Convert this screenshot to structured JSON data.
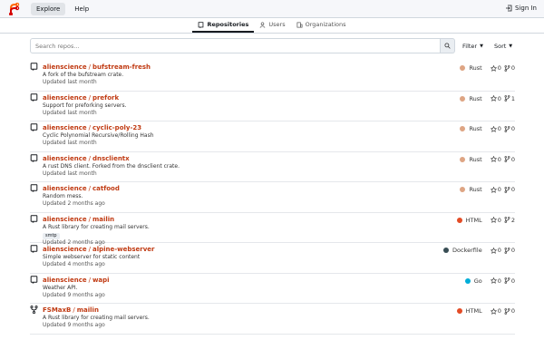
{
  "nav": {
    "explore": "Explore",
    "help": "Help",
    "signin": "Sign In"
  },
  "tabs": [
    {
      "label": "Repositories",
      "icon": "repo-icon"
    },
    {
      "label": "Users",
      "icon": "person-icon"
    },
    {
      "label": "Organizations",
      "icon": "organization-icon"
    }
  ],
  "search": {
    "placeholder": "Search repos..."
  },
  "filters": {
    "filter": "Filter",
    "sort": "Sort"
  },
  "colors": {
    "accent": "#c03a12",
    "Rust": "#dea584",
    "HTML": "#e34c26",
    "Dockerfile": "#384d54",
    "Go": "#00add8"
  },
  "repos": [
    {
      "owner": "alienscience",
      "name": "bufstream-fresh",
      "desc": "A fork of the bufstream crate.",
      "updated": "Updated last month",
      "lang": "Rust",
      "stars": "0",
      "forks": "0",
      "icon": "repo-icon"
    },
    {
      "owner": "alienscience",
      "name": "prefork",
      "desc": "Support for preforking servers.",
      "updated": "Updated last month",
      "lang": "Rust",
      "stars": "0",
      "forks": "1",
      "icon": "repo-icon"
    },
    {
      "owner": "alienscience",
      "name": "cyclic-poly-23",
      "desc": "Cyclic Polynomial Recursive/Rolling Hash",
      "updated": "Updated last month",
      "lang": "Rust",
      "stars": "0",
      "forks": "0",
      "icon": "repo-icon"
    },
    {
      "owner": "alienscience",
      "name": "dnsclientx",
      "desc": "A rust DNS client. Forked from the dnsclient crate.",
      "updated": "Updated last month",
      "lang": "Rust",
      "stars": "0",
      "forks": "0",
      "icon": "repo-icon"
    },
    {
      "owner": "alienscience",
      "name": "catfood",
      "desc": "Random mess.",
      "updated": "Updated 2 months ago",
      "lang": "Rust",
      "stars": "0",
      "forks": "0",
      "icon": "repo-icon"
    },
    {
      "owner": "alienscience",
      "name": "mailin",
      "desc": "A Rust library for creating mail servers.",
      "topic": "smtp",
      "updated": "Updated 2 months ago",
      "lang": "HTML",
      "stars": "0",
      "forks": "2",
      "icon": "repo-icon"
    },
    {
      "owner": "alienscience",
      "name": "alpine-webserver",
      "desc": "Simple webserver for static content",
      "updated": "Updated 4 months ago",
      "lang": "Dockerfile",
      "stars": "0",
      "forks": "0",
      "icon": "repo-icon"
    },
    {
      "owner": "alienscience",
      "name": "wapi",
      "desc": "Weather API.",
      "updated": "Updated 9 months ago",
      "lang": "Go",
      "stars": "0",
      "forks": "0",
      "icon": "repo-icon"
    },
    {
      "owner": "FSMaxB",
      "name": "mailin",
      "desc": "A Rust library for creating mail servers.",
      "updated": "Updated 9 months ago",
      "lang": "HTML",
      "stars": "0",
      "forks": "0",
      "icon": "fork-icon"
    }
  ]
}
